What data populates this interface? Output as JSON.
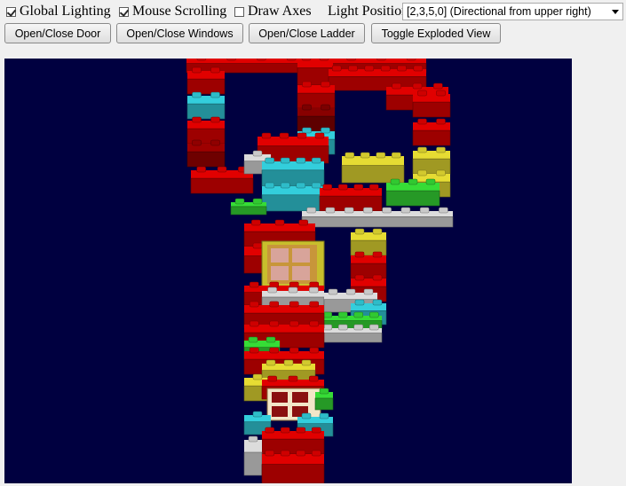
{
  "controls": {
    "global_lighting": {
      "label": "Global Lighting",
      "checked": true
    },
    "mouse_scrolling": {
      "label": "Mouse Scrolling",
      "checked": true
    },
    "draw_axes": {
      "label": "Draw Axes",
      "checked": false
    },
    "light_position_label": "Light Position:",
    "light_position_value": "[2,3,5,0] (Directional from upper right)"
  },
  "buttons": {
    "door": "Open/Close Door",
    "windows": "Open/Close Windows",
    "ladder": "Open/Close Ladder",
    "exploded": "Toggle Exploded View"
  },
  "scene": {
    "background": "#000040",
    "colors": {
      "red": "#c40000",
      "teal": "#2cb3bf",
      "yellow": "#c8bf2c",
      "grey": "#bfbfbf",
      "green": "#2fbf2f",
      "window_frame": "#f2e6c8"
    }
  }
}
